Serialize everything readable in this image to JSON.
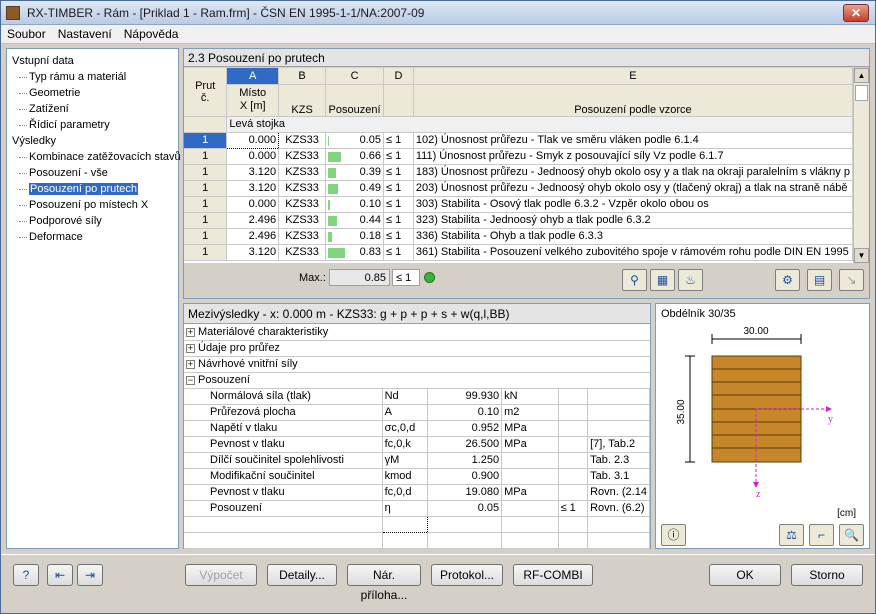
{
  "window": {
    "title": "RX-TIMBER - Rám - [Priklad 1 - Ram.frm] - ČSN EN 1995-1-1/NA:2007-09",
    "close": "✕"
  },
  "menu": [
    "Soubor",
    "Nastavení",
    "Nápověda"
  ],
  "nav": {
    "groups": [
      {
        "label": "Vstupní data",
        "items": [
          "Typ rámu a materiál",
          "Geometrie",
          "Zatížení",
          "Řídicí parametry"
        ]
      },
      {
        "label": "Výsledky",
        "items": [
          "Kombinace zatěžovacích stavů",
          "Posouzení - vše",
          "Posouzení po prutech",
          "Posouzení po místech X",
          "Podporové síly",
          "Deformace"
        ]
      }
    ],
    "selected": "Posouzení po prutech"
  },
  "top": {
    "title": "2.3 Posouzení po prutech",
    "columns": {
      "letters": [
        "A",
        "B",
        "C",
        "D",
        "E"
      ],
      "rowhead": "Prut\nč.",
      "a": "Místo\nX [m]",
      "b": "KZS",
      "c": "Posouzení",
      "d": "",
      "e": "Posouzení podle vzorce"
    },
    "group": "Levá stojka",
    "rows": [
      {
        "prut": "1",
        "x": "0.000",
        "kzs": "KZS33",
        "pos": "0.05",
        "pos_val": 0.05,
        "le": "≤ 1",
        "vz": "102) Únosnost průřezu - Tlak ve směru vláken podle 6.1.4"
      },
      {
        "prut": "1",
        "x": "0.000",
        "kzs": "KZS33",
        "pos": "0.66",
        "pos_val": 0.66,
        "le": "≤ 1",
        "vz": "111) Únosnost průřezu - Smyk z posouvající síly Vz podle 6.1.7"
      },
      {
        "prut": "1",
        "x": "3.120",
        "kzs": "KZS33",
        "pos": "0.39",
        "pos_val": 0.39,
        "le": "≤ 1",
        "vz": "183) Únosnost průřezu - Jednoosý ohyb okolo osy y a tlak na okraji paralelním s vlákny p"
      },
      {
        "prut": "1",
        "x": "3.120",
        "kzs": "KZS33",
        "pos": "0.49",
        "pos_val": 0.49,
        "le": "≤ 1",
        "vz": "203) Únosnost průřezu - Jednoosý ohyb okolo osy y (tlačený okraj) a tlak na straně nábě"
      },
      {
        "prut": "1",
        "x": "0.000",
        "kzs": "KZS33",
        "pos": "0.10",
        "pos_val": 0.1,
        "le": "≤ 1",
        "vz": "303) Stabilita - Osový tlak podle 6.3.2 - Vzpěr okolo obou os"
      },
      {
        "prut": "1",
        "x": "2.496",
        "kzs": "KZS33",
        "pos": "0.44",
        "pos_val": 0.44,
        "le": "≤ 1",
        "vz": "323) Stabilita - Jednoosý ohyb a tlak podle 6.3.2"
      },
      {
        "prut": "1",
        "x": "2.496",
        "kzs": "KZS33",
        "pos": "0.18",
        "pos_val": 0.18,
        "le": "≤ 1",
        "vz": "336) Stabilita - Ohyb a tlak podle 6.3.3"
      },
      {
        "prut": "1",
        "x": "3.120",
        "kzs": "KZS33",
        "pos": "0.83",
        "pos_val": 0.83,
        "le": "≤ 1",
        "vz": "361) Stabilita - Posouzení velkého zubovitého spoje v rámovém rohu podle DIN EN 1995"
      }
    ],
    "max_label": "Max.:",
    "max_val": "0.85",
    "max_le": "≤ 1"
  },
  "mid": {
    "title": "Mezivýsledky  -  x: 0.000 m  -  KZS33: g + p + p + s + w(q,l,BB)",
    "sections": [
      "Materiálové charakteristiky",
      "Údaje pro průřez",
      "Návrhové vnitřní síly",
      "Posouzení"
    ],
    "rows": [
      {
        "name": "Normálová síla (tlak)",
        "sym": "Nd",
        "val": "99.930",
        "unit": "kN",
        "le": "",
        "ref": ""
      },
      {
        "name": "Průřezová plocha",
        "sym": "A",
        "val": "0.10",
        "unit": "m2",
        "le": "",
        "ref": ""
      },
      {
        "name": "Napětí v tlaku",
        "sym": "σc,0,d",
        "val": "0.952",
        "unit": "MPa",
        "le": "",
        "ref": ""
      },
      {
        "name": "Pevnost v tlaku",
        "sym": "fc,0,k",
        "val": "26.500",
        "unit": "MPa",
        "le": "",
        "ref": "[7], Tab.2"
      },
      {
        "name": "Dílčí součinitel spolehlivosti",
        "sym": "γM",
        "val": "1.250",
        "unit": "",
        "le": "",
        "ref": "Tab. 2.3"
      },
      {
        "name": "Modifikační součinitel",
        "sym": "kmod",
        "val": "0.900",
        "unit": "",
        "le": "",
        "ref": "Tab. 3.1"
      },
      {
        "name": "Pevnost v tlaku",
        "sym": "fc,0,d",
        "val": "19.080",
        "unit": "MPa",
        "le": "",
        "ref": "Rovn. (2.14"
      },
      {
        "name": "Posouzení",
        "sym": "η",
        "val": "0.05",
        "unit": "",
        "le": "≤ 1",
        "ref": "Rovn. (6.2)"
      }
    ]
  },
  "section": {
    "caption": "Obdélník 30/35",
    "width": "30.00",
    "height": "35.00",
    "axis_y": "y",
    "axis_z": "z",
    "unit": "[cm]"
  },
  "footer": {
    "vypocet": "Výpočet",
    "detaily": "Detaily...",
    "narpriloha": "Nár. příloha...",
    "protokol": "Protokol...",
    "rfcombi": "RF-COMBI",
    "ok": "OK",
    "storno": "Storno"
  }
}
